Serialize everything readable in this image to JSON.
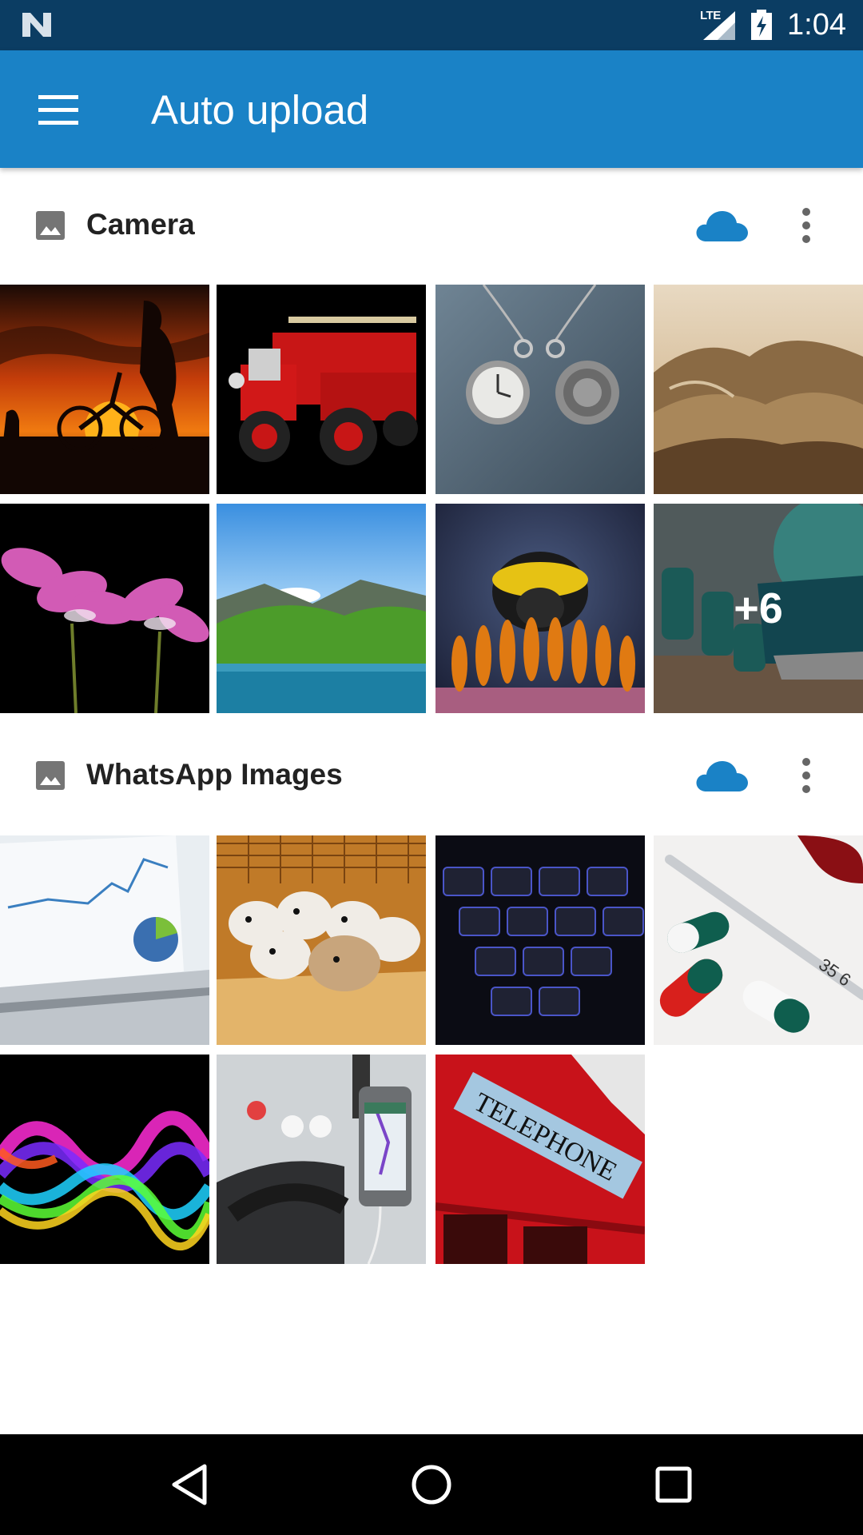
{
  "status_bar": {
    "network": "LTE",
    "time": "1:04",
    "icons": [
      "n-logo-icon",
      "signal-icon",
      "battery-charging-icon"
    ]
  },
  "app_bar": {
    "title": "Auto upload",
    "menu_icon": "hamburger-menu-icon"
  },
  "folders": [
    {
      "name": "Camera",
      "icon": "image-folder-icon",
      "status_icon": "cloud-icon",
      "more_icon": "more-vertical-icon",
      "thumbnails": [
        "sunset-bicycle",
        "red-fire-truck",
        "pocket-watches",
        "mountain-hills",
        "pink-flowers",
        "alpine-lake",
        "bumblebee",
        "dumbbells-shoes"
      ],
      "more_count": "+6"
    },
    {
      "name": "WhatsApp Images",
      "icon": "image-folder-icon",
      "status_icon": "cloud-icon",
      "more_icon": "more-vertical-icon",
      "thumbnails": [
        "laptop-chart",
        "hamsters",
        "keyboard",
        "pills-thermometer",
        "rainbow-waves",
        "car-phone-navigation",
        "red-telephone-booth"
      ]
    }
  ],
  "telephone_sign": "TELEPHONE",
  "thermometer_marks": "35 6",
  "nav_bar": {
    "back_icon": "back-triangle-icon",
    "home_icon": "home-circle-icon",
    "recents_icon": "recents-square-icon"
  },
  "colors": {
    "status_bar": "#0b3d63",
    "app_bar": "#1a82c6",
    "cloud_accent": "#1a82c6"
  }
}
